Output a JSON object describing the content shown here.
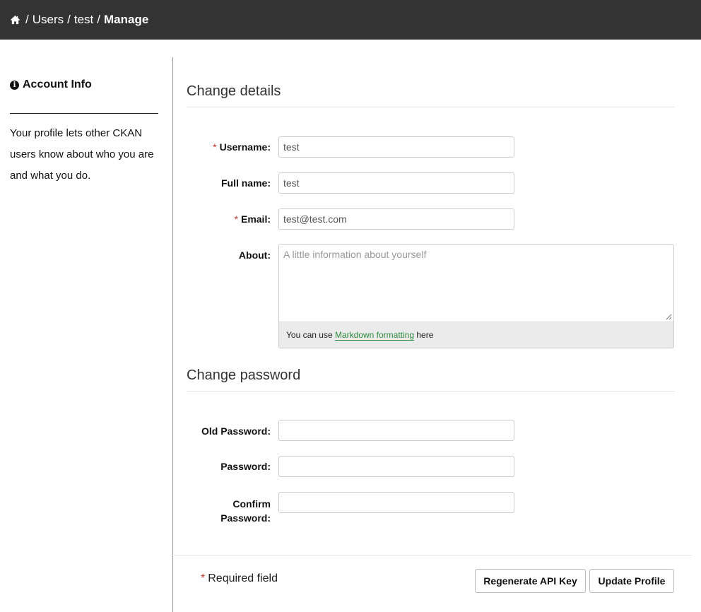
{
  "breadcrumb": {
    "home_icon": "home-icon",
    "items": [
      "Users",
      "test"
    ],
    "current": "Manage",
    "separator": "/"
  },
  "sidebar": {
    "title": "Account Info",
    "icon": "info-circle-icon",
    "text": "Your profile lets other CKAN users know about who you are and what you do."
  },
  "details": {
    "title": "Change details",
    "username_label": "Username:",
    "username_value": "test",
    "fullname_label": "Full name:",
    "fullname_value": "test",
    "email_label": "Email:",
    "email_value": "test@test.com",
    "about_label": "About:",
    "about_placeholder": "A little information about yourself",
    "about_hint_prefix": "You can use",
    "about_hint_link": "Markdown formatting",
    "about_hint_suffix": "here"
  },
  "password": {
    "title": "Change password",
    "old_label": "Old Password:",
    "new_label": "Password:",
    "confirm_label_line1": "Confirm",
    "confirm_label_line2": "Password:"
  },
  "footer": {
    "required_marker": "*",
    "required_note": "Required field",
    "regenerate_label": "Regenerate API Key",
    "update_label": "Update Profile"
  },
  "colors": {
    "topbar": "#333333",
    "required": "#c6362f",
    "link": "#2e8a3e"
  }
}
